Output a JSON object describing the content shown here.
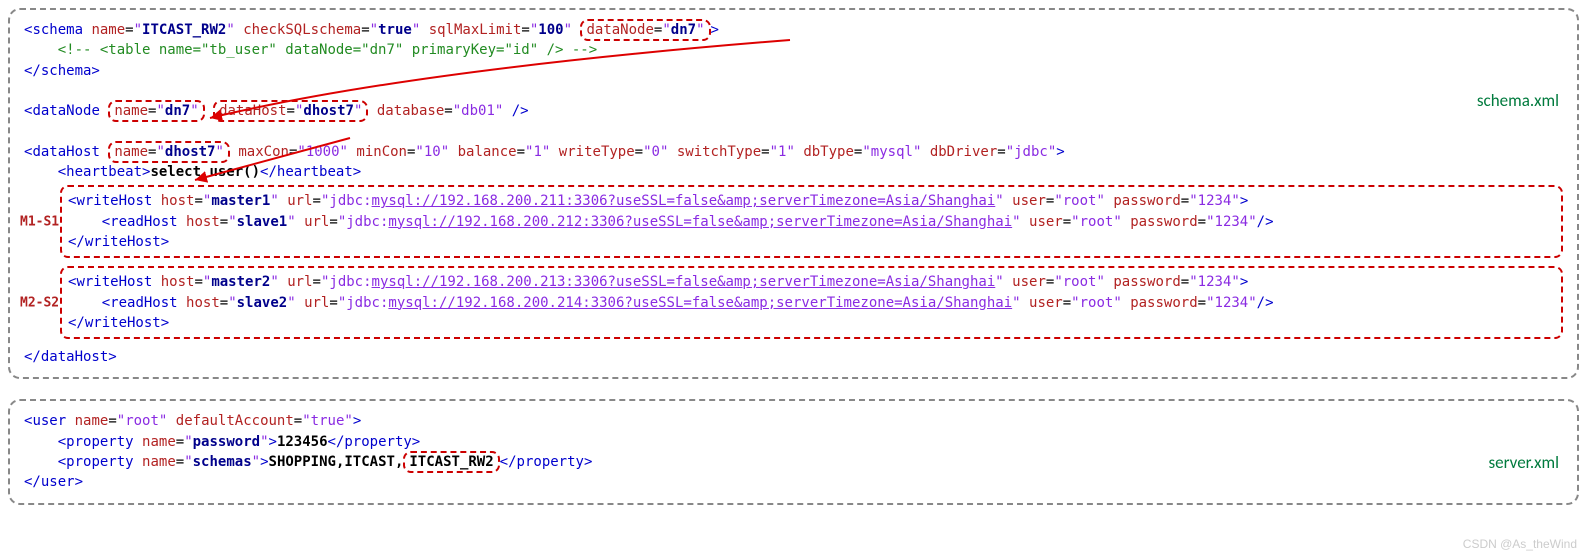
{
  "file1_label": "schema.xml",
  "file2_label": "server.xml",
  "schema": {
    "tag": "schema",
    "name_attr": "name",
    "name_val": "ITCAST_RW2",
    "check_attr": "checkSQLschema",
    "check_val": "true",
    "sql_attr": "sqlMaxLimit",
    "sql_val": "100",
    "dn_attr": "dataNode",
    "dn_val": "dn7",
    "comment": "<!-- <table name=\"tb_user\" dataNode=\"dn7\" primaryKey=\"id\" /> -->",
    "close": "</schema>"
  },
  "dataNode": {
    "tag": "dataNode",
    "name_attr": "name",
    "name_val": "dn7",
    "host_attr": "dataHost",
    "host_val": "dhost7",
    "db_attr": "database",
    "db_val": "db01"
  },
  "dataHost": {
    "tag": "dataHost",
    "name_attr": "name",
    "name_val": "dhost7",
    "maxcon_attr": "maxCon",
    "maxcon_val": "1000",
    "mincon_attr": "minCon",
    "mincon_val": "10",
    "balance_attr": "balance",
    "balance_val": "1",
    "write_attr": "writeType",
    "write_val": "0",
    "switch_attr": "switchType",
    "switch_val": "1",
    "dbtype_attr": "dbType",
    "dbtype_val": "mysql",
    "driver_attr": "dbDriver",
    "driver_val": "jdbc",
    "hb_tag": "heartbeat",
    "hb_val": "select user()",
    "close": "</dataHost>"
  },
  "group1": {
    "side": "M1-S1",
    "wh": {
      "tag": "writeHost",
      "host_attr": "host",
      "host_val": "master1",
      "url_attr": "url",
      "url_pre": "jdbc:",
      "url_link": "mysql://192.168.200.211:3306?useSSL=false&amp;serverTimezone=Asia/Shanghai",
      "user_attr": "user",
      "user_val": "root",
      "pw_attr": "password",
      "pw_val": "1234"
    },
    "rh": {
      "tag": "readHost",
      "host_attr": "host",
      "host_val": "slave1",
      "url_attr": "url",
      "url_pre": "jdbc:",
      "url_link": "mysql://192.168.200.212:3306?useSSL=false&amp;serverTimezone=Asia/Shanghai",
      "user_attr": "user",
      "user_val": "root",
      "pw_attr": "password",
      "pw_val": "1234"
    },
    "close": "</writeHost>"
  },
  "group2": {
    "side": "M2-S2",
    "wh": {
      "tag": "writeHost",
      "host_attr": "host",
      "host_val": "master2",
      "url_attr": "url",
      "url_pre": "jdbc:",
      "url_link": "mysql://192.168.200.213:3306?useSSL=false&amp;serverTimezone=Asia/Shanghai",
      "user_attr": "user",
      "user_val": "root",
      "pw_attr": "password",
      "pw_val": "1234"
    },
    "rh": {
      "tag": "readHost",
      "host_attr": "host",
      "host_val": "slave2",
      "url_attr": "url",
      "url_pre": "jdbc:",
      "url_link": "mysql://192.168.200.214:3306?useSSL=false&amp;serverTimezone=Asia/Shanghai",
      "user_attr": "user",
      "user_val": "root",
      "pw_attr": "password",
      "pw_val": "1234"
    },
    "close": "</writeHost>"
  },
  "user": {
    "tag": "user",
    "name_attr": "name",
    "name_val": "root",
    "def_attr": "defaultAccount",
    "def_val": "true",
    "prop_tag": "property",
    "p1_name": "name",
    "p1_val": "password",
    "p1_text": "123456",
    "p2_name": "name",
    "p2_val": "schemas",
    "p2_prefix": "SHOPPING,ITCAST,",
    "p2_hl": "ITCAST_RW2",
    "prop_close": "</property>",
    "close": "</user>"
  },
  "watermark": "CSDN @As_theWind"
}
